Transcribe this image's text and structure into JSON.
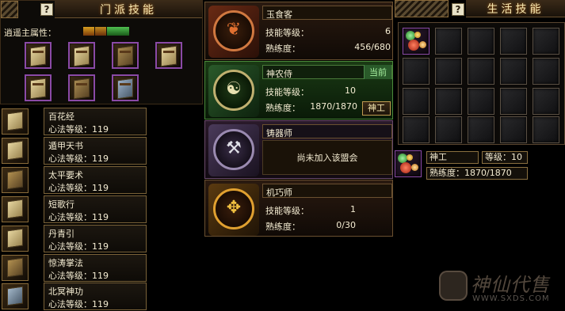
{
  "sect_panel": {
    "help": "?",
    "title": "门派技能",
    "attr_label": "逍遥主属性："
  },
  "sect_skills": [
    {
      "name": "百花经",
      "level": "心法等级：119"
    },
    {
      "name": "遁甲天书",
      "level": "心法等级：119"
    },
    {
      "name": "太平要术",
      "level": "心法等级：119"
    },
    {
      "name": "短歌行",
      "level": "心法等级：119"
    },
    {
      "name": "丹青引",
      "level": "心法等级：119"
    },
    {
      "name": "惊涛掌法",
      "level": "心法等级：119"
    },
    {
      "name": "北冥神功",
      "level": "心法等级：119"
    }
  ],
  "life_skills": [
    {
      "name": "玉食客",
      "skill_label": "技能等级：",
      "skill_value": "6",
      "prof_label": "熟练度：",
      "prof_value": "456/680"
    },
    {
      "name": "神农侍",
      "current": "当前",
      "skill_label": "技能等级：",
      "skill_value": "10",
      "prof_label": "熟练度：",
      "prof_value": "1870/1870",
      "button": "神工"
    },
    {
      "name": "铸器师",
      "message": "尚未加入该盟会"
    },
    {
      "name": "机巧师",
      "skill_label": "技能等级：",
      "skill_value": "1",
      "prof_label": "熟练度：",
      "prof_value": "0/30"
    }
  ],
  "life_panel": {
    "help": "?",
    "title": "生活技能",
    "selected_name": "神工",
    "selected_level": "等级：10",
    "selected_prof": "熟练度：1870/1870"
  },
  "watermark": {
    "brand": "神仙代售",
    "url": "WWW.SXDS.COM"
  },
  "colors": {
    "panel_bg": "#0d0b08",
    "gold_border": "#8a6c3a",
    "purple_border": "#8a4aa6",
    "title_text": "#f6e7b0",
    "current_green": "#2a5a2a"
  }
}
